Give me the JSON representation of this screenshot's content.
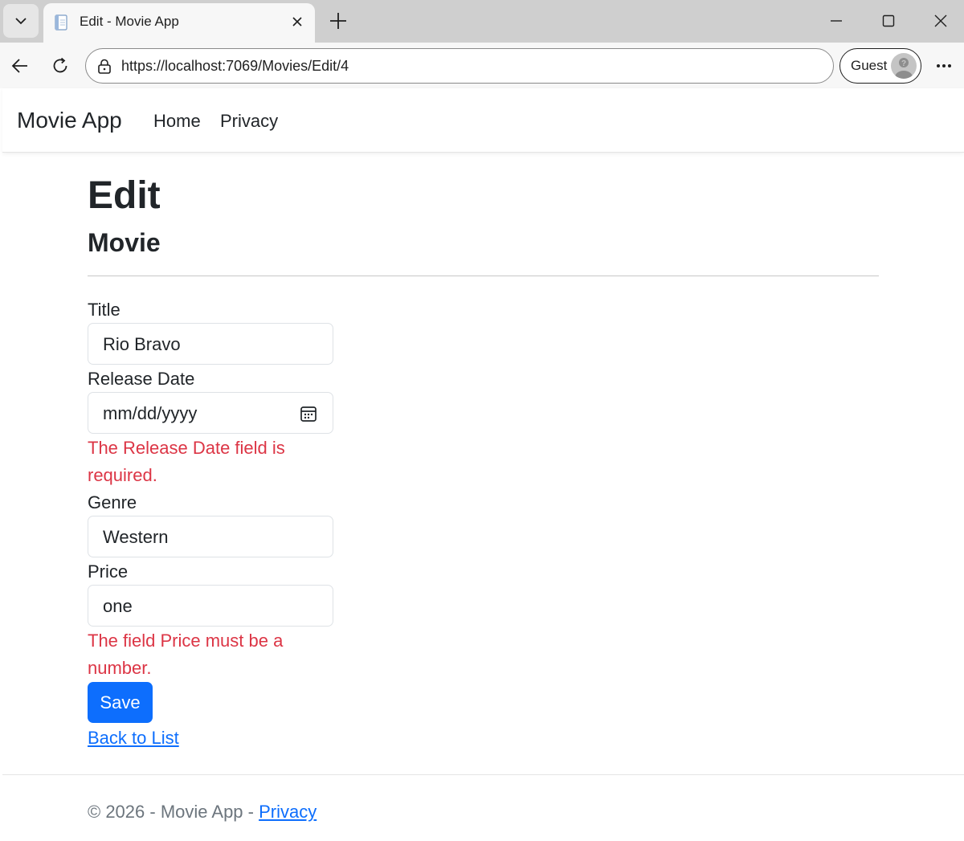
{
  "browser": {
    "tab_title": "Edit - Movie App",
    "url": "https://localhost:7069/Movies/Edit/4",
    "profile_label": "Guest"
  },
  "navbar": {
    "brand": "Movie App",
    "links": [
      "Home",
      "Privacy"
    ]
  },
  "page": {
    "title": "Edit",
    "subtitle": "Movie"
  },
  "form": {
    "title": {
      "label": "Title",
      "value": "Rio Bravo"
    },
    "release_date": {
      "label": "Release Date",
      "placeholder": "mm/dd/yyyy",
      "error": "The Release Date field is required."
    },
    "genre": {
      "label": "Genre",
      "value": "Western"
    },
    "price": {
      "label": "Price",
      "value": "one",
      "error": "The field Price must be a number."
    },
    "save_label": "Save",
    "back_label": "Back to List"
  },
  "footer": {
    "text": "© 2026 - Movie App - ",
    "link": "Privacy"
  },
  "colors": {
    "primary": "#0d6efd",
    "danger": "#dc3545",
    "text": "#212529",
    "muted": "#6c757d"
  },
  "icons": {
    "tab_list": "chevron-down-icon",
    "favicon": "page-favicon-icon",
    "tab_close": "close-icon",
    "new_tab": "plus-icon",
    "back": "arrow-left-icon",
    "reload": "reload-icon",
    "site_info": "lock-icon",
    "calendar": "calendar-icon",
    "more": "more-icon"
  }
}
